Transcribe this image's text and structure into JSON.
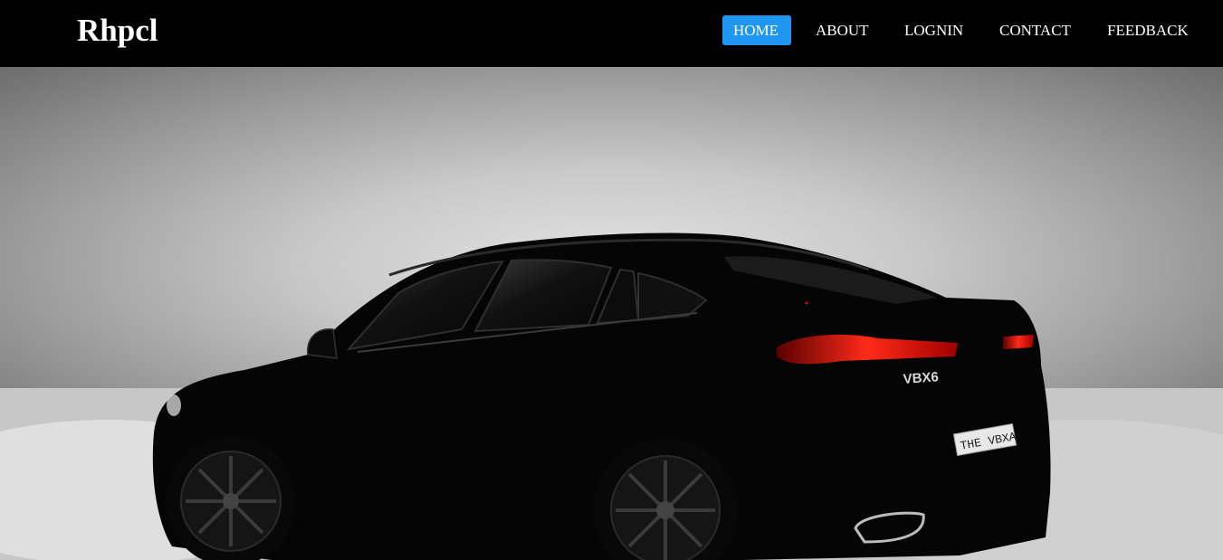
{
  "header": {
    "brand": "Rhpcl",
    "nav": [
      {
        "label": "HOME",
        "active": true
      },
      {
        "label": "ABOUT",
        "active": false
      },
      {
        "label": "LOGNIN",
        "active": false
      },
      {
        "label": "CONTACT",
        "active": false
      },
      {
        "label": "FEEDBACK",
        "active": false
      }
    ]
  },
  "hero": {
    "badge_text": "VBX6",
    "plate_text": "THE VBXA"
  },
  "colors": {
    "navbar_bg": "#000000",
    "active_nav_bg": "#1f97f2",
    "nav_text": "#ffffff"
  }
}
